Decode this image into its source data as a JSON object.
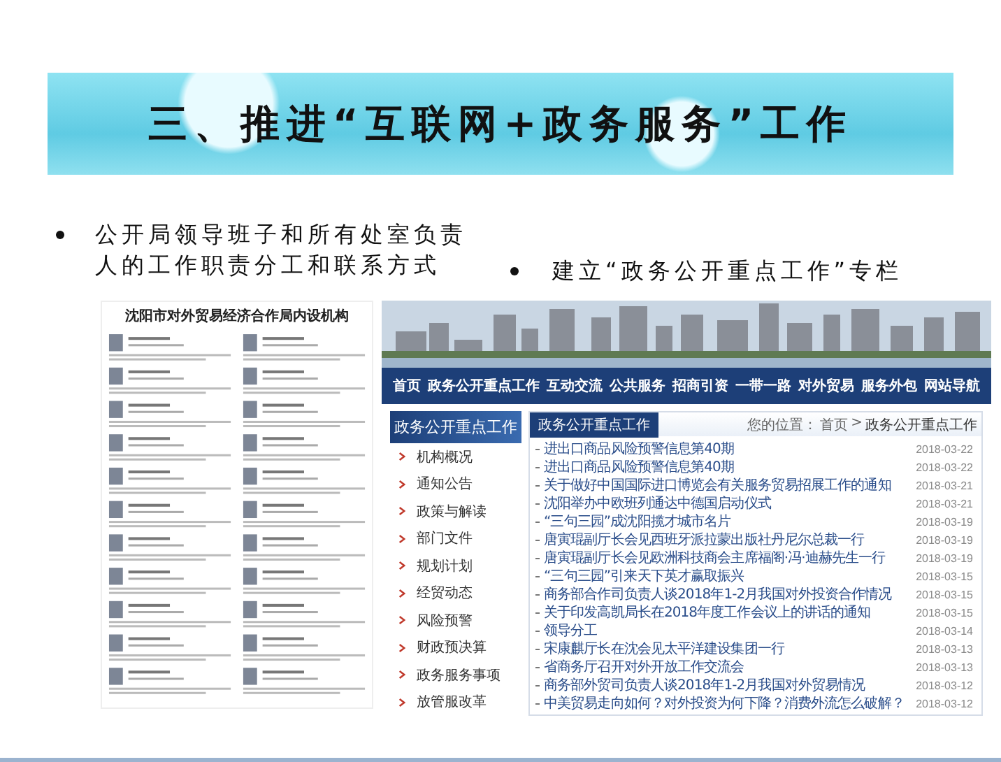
{
  "slide": {
    "title": "三、推进“互联网+政务服务”工作",
    "bullets": [
      {
        "text": "公开局领导班子和所有处室负责人的工作职责分工和联系方式"
      },
      {
        "text": "建立“政务公开重点工作”专栏"
      }
    ]
  },
  "document": {
    "title": "沈阳市对外贸易经济合作局内设机构"
  },
  "website": {
    "nav": [
      "首页",
      "政务公开重点工作",
      "互动交流",
      "公共服务",
      "招商引资",
      "一带一路",
      "对外贸易",
      "服务外包",
      "网站导航"
    ],
    "sidebar": {
      "heading": "政务公开重点工作",
      "items": [
        "机构概况",
        "通知公告",
        "政策与解读",
        "部门文件",
        "规划计划",
        "经贸动态",
        "风险预警",
        "财政预决算",
        "政务服务事项",
        "放管服改革"
      ]
    },
    "panel": {
      "title": "政务公开重点工作",
      "breadcrumb": {
        "prefix": "您的位置：",
        "items": [
          "首页",
          "政务公开重点工作"
        ],
        "separator": ">"
      },
      "news": [
        {
          "title": "进出口商品风险预警信息第40期",
          "date": "2018-03-22"
        },
        {
          "title": "进出口商品风险预警信息第40期",
          "date": "2018-03-22"
        },
        {
          "title": "关于做好中国国际进口博览会有关服务贸易招展工作的通知",
          "date": "2018-03-21"
        },
        {
          "title": "沈阳举办中欧班列通达中德国启动仪式",
          "date": "2018-03-21"
        },
        {
          "title": "“三句三园”成沈阳揽才城市名片",
          "date": "2018-03-19"
        },
        {
          "title": "唐寅琨副厅长会见西班牙派拉蒙出版社丹尼尔总裁一行",
          "date": "2018-03-19"
        },
        {
          "title": "唐寅琨副厅长会见欧洲科技商会主席福阁·冯·迪赫先生一行",
          "date": "2018-03-19"
        },
        {
          "title": "“三句三园”引来天下英才赢取振兴",
          "date": "2018-03-15"
        },
        {
          "title": "商务部合作司负责人谈2018年1-2月我国对外投资合作情况",
          "date": "2018-03-15"
        },
        {
          "title": "关于印发高凯局长在2018年度工作会议上的讲话的通知",
          "date": "2018-03-15"
        },
        {
          "title": "领导分工",
          "date": "2018-03-14"
        },
        {
          "title": "宋康麒厅长在沈会见太平洋建设集团一行",
          "date": "2018-03-13"
        },
        {
          "title": "省商务厅召开对外开放工作交流会",
          "date": "2018-03-13"
        },
        {
          "title": "商务部外贸司负责人谈2018年1-2月我国对外贸易情况",
          "date": "2018-03-12"
        },
        {
          "title": "中美贸易走向如何？对外投资为何下降？消费外流怎么破解？",
          "date": "2018-03-12"
        }
      ]
    }
  }
}
